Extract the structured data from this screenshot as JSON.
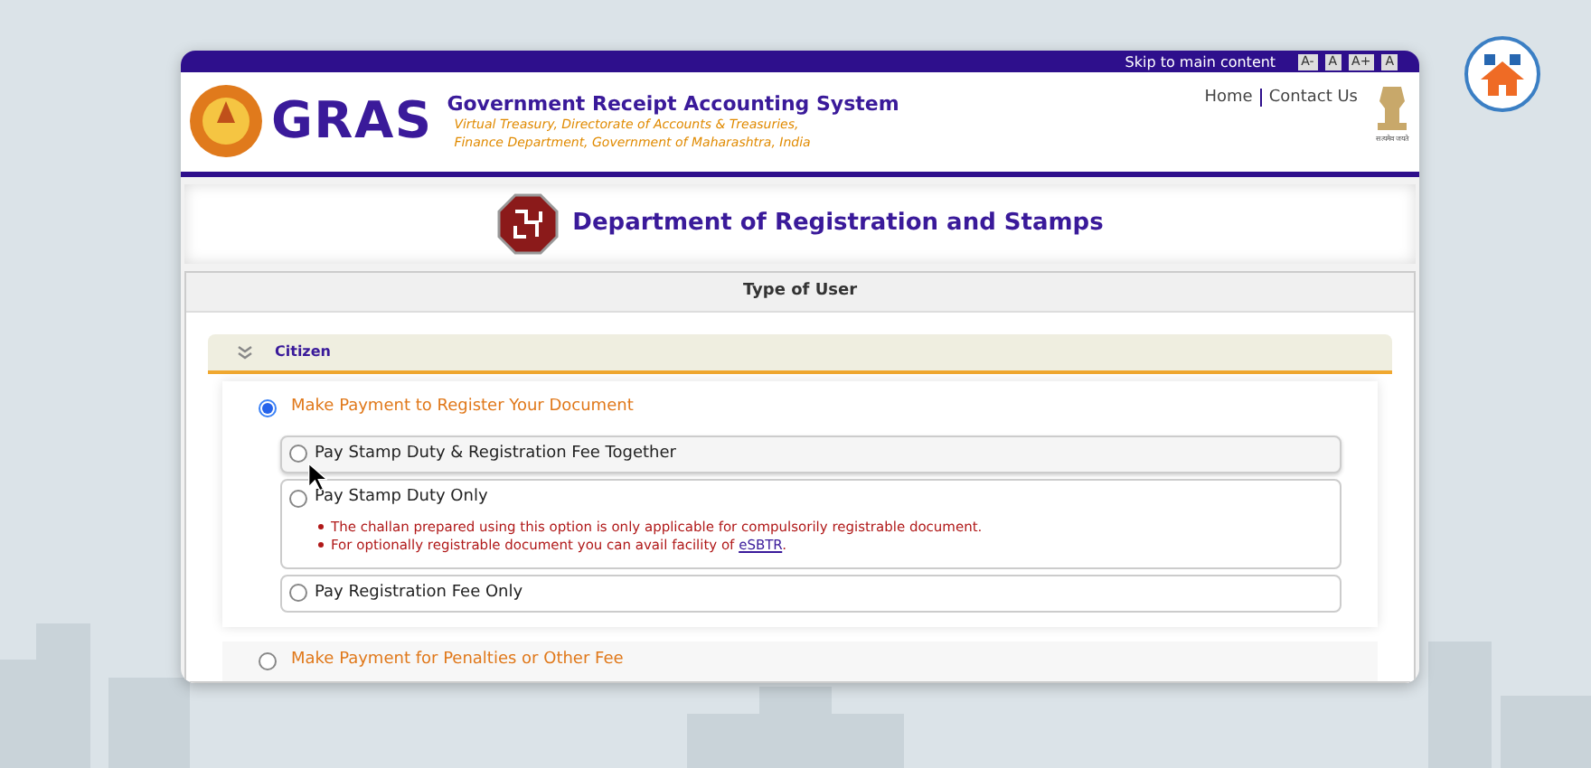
{
  "top_bar": {
    "skip_link": "Skip to main content",
    "font_buttons": [
      "A-",
      "A",
      "A+",
      "A"
    ]
  },
  "header": {
    "logo_text": "GRAS",
    "title": "Government Receipt Accounting System",
    "subtitle_lines": [
      "Virtual Treasury, Directorate of Accounts & Treasuries,",
      "Finance Department, Government of Maharashtra, India"
    ],
    "nav": [
      "Home",
      "Contact Us"
    ],
    "emblem_caption": "सत्यमेव जयते"
  },
  "department": {
    "title": "Department of Registration and Stamps"
  },
  "panel": {
    "title": "Type of User",
    "section": {
      "title": "Citizen",
      "expanded": true
    },
    "main_options": [
      {
        "label": "Make Payment to Register Your Document",
        "selected": true,
        "sub_options": [
          {
            "label": "Pay Stamp Duty & Registration Fee Together",
            "selected": false,
            "hovered": true
          },
          {
            "label": "Pay Stamp Duty Only",
            "selected": false,
            "hovered": false,
            "notes": [
              {
                "text": "The challan prepared using this option is only applicable for compulsorily registrable document."
              },
              {
                "text": "For optionally registrable document you can avail facility of ",
                "link": "eSBTR",
                "after": "."
              }
            ]
          },
          {
            "label": "Pay Registration Fee Only",
            "selected": false,
            "hovered": false
          }
        ]
      },
      {
        "label": "Make Payment for Penalties or Other Fee",
        "selected": false
      }
    ]
  }
}
